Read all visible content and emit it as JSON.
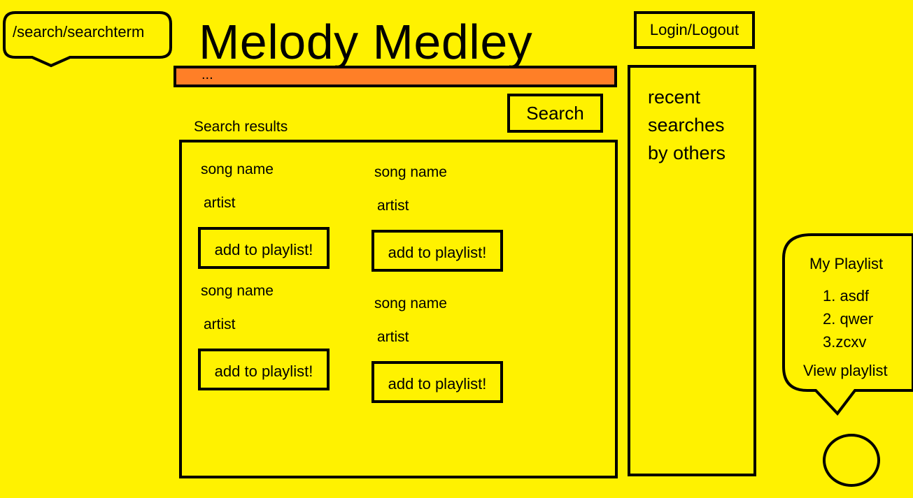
{
  "url_bubble": {
    "text": "/search/searchterm"
  },
  "header": {
    "title": "Melody Medley",
    "login_label": "Login/Logout"
  },
  "search": {
    "value": "...",
    "button_label": "Search"
  },
  "results": {
    "label": "Search results",
    "items": [
      {
        "song": "song name",
        "artist": "artist",
        "button": "add to playlist!"
      },
      {
        "song": "song name",
        "artist": "artist",
        "button": "add to playlist!"
      },
      {
        "song": "song name",
        "artist": "artist",
        "button": "add to playlist!"
      },
      {
        "song": "song name",
        "artist": "artist",
        "button": "add to playlist!"
      }
    ]
  },
  "recent": {
    "lines": [
      "recent",
      "searches",
      "by others"
    ]
  },
  "playlist": {
    "title": "My Playlist",
    "items": [
      "1. asdf",
      "2. qwer",
      "3.zcxv"
    ],
    "view_label": "View playlist"
  },
  "colors": {
    "background": "#fff200",
    "searchbar": "#ff7f27",
    "border": "#000000"
  }
}
